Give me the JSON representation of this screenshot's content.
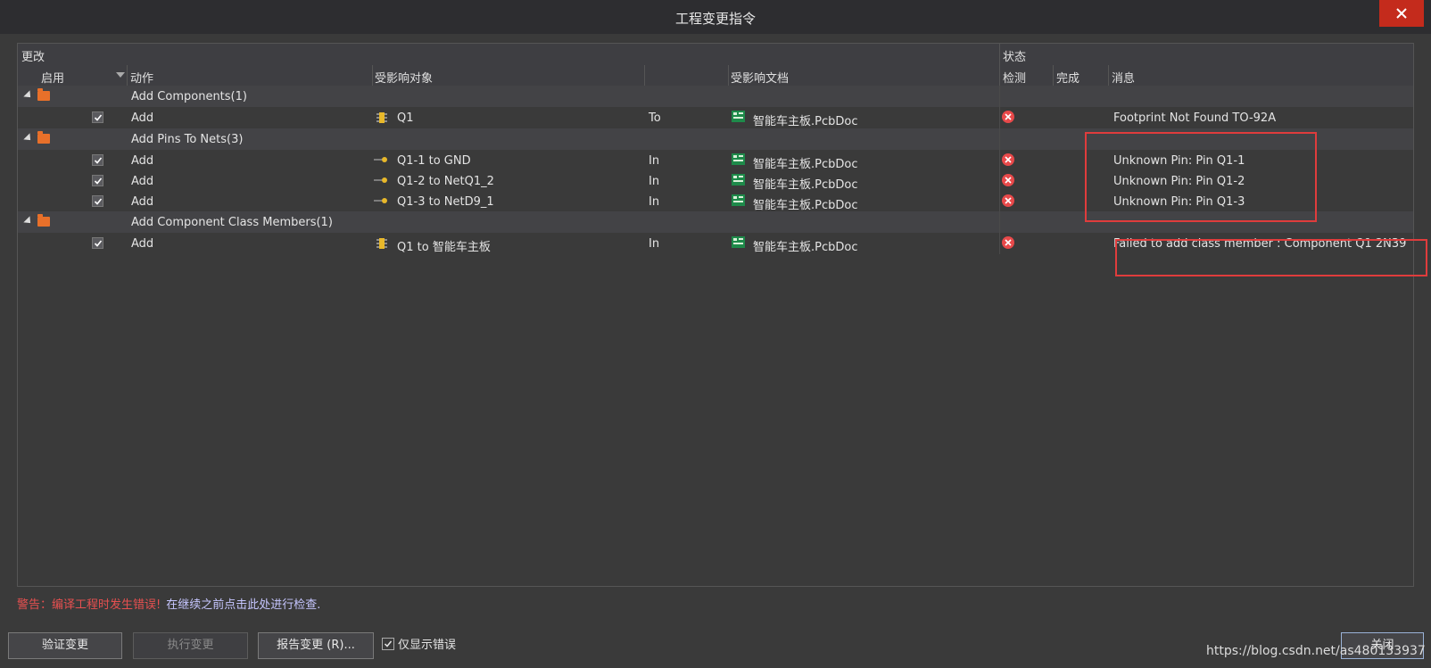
{
  "window": {
    "title": "工程变更指令"
  },
  "header": {
    "group_changes": "更改",
    "group_status": "状态",
    "col_enable": "启用",
    "col_action": "动作",
    "col_affected_object": "受影响对象",
    "col_affected_document": "受影响文档",
    "col_check": "检测",
    "col_done": "完成",
    "col_message": "消息"
  },
  "groups": [
    {
      "label": "Add Components(1)"
    },
    {
      "label": "Add Pins To Nets(3)"
    },
    {
      "label": "Add Component Class Members(1)"
    }
  ],
  "rows": [
    {
      "action": "Add",
      "object": "Q1",
      "prep": "To",
      "document": "智能车主板.PcbDoc",
      "message": "Footprint Not Found TO-92A"
    },
    {
      "action": "Add",
      "object": "Q1-1 to GND",
      "prep": "In",
      "document": "智能车主板.PcbDoc",
      "message": "Unknown Pin: Pin Q1-1"
    },
    {
      "action": "Add",
      "object": "Q1-2 to NetQ1_2",
      "prep": "In",
      "document": "智能车主板.PcbDoc",
      "message": "Unknown Pin: Pin Q1-2"
    },
    {
      "action": "Add",
      "object": "Q1-3 to NetD9_1",
      "prep": "In",
      "document": "智能车主板.PcbDoc",
      "message": "Unknown Pin: Pin Q1-3"
    },
    {
      "action": "Add",
      "object": "Q1 to 智能车主板",
      "prep": "In",
      "document": "智能车主板.PcbDoc",
      "message": "Failed to add class member : Component Q1 2N39"
    }
  ],
  "warning": {
    "prefix": "警告：编译工程时发生错误!",
    "suffix": "在继续之前点击此处进行检查."
  },
  "buttons": {
    "validate": "验证变更",
    "execute": "执行变更",
    "report": "报告变更 (R)...",
    "only_errors": "仅显示错误",
    "close": "关闭"
  },
  "watermark": "https://blog.csdn.net/as480133937",
  "colors": {
    "error": "#e8494a",
    "highlight_box": "#e03c3c",
    "close_button": "#c42b1c",
    "folder": "#e8702a"
  }
}
